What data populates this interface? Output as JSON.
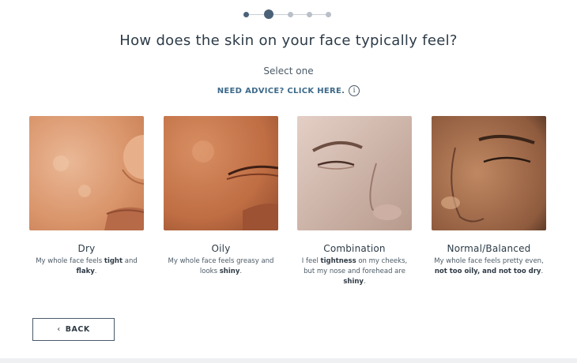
{
  "stepper": {
    "total_steps": 5,
    "current_step": 2
  },
  "page": {
    "title": "How does the skin on your face typically feel?",
    "subtitle": "Select one",
    "advice_link": "NEED ADVICE? CLICK HERE."
  },
  "options": [
    {
      "title": "Dry",
      "desc_parts": [
        "My whole face feels ",
        "tight",
        " and ",
        "flaky",
        "."
      ]
    },
    {
      "title": "Oily",
      "desc_parts": [
        "My whole face feels greasy and looks ",
        "shiny",
        "."
      ]
    },
    {
      "title": "Combination",
      "desc_parts": [
        "I feel ",
        "tightness",
        " on my cheeks, but my nose and forehead are ",
        "shiny",
        "."
      ]
    },
    {
      "title": "Normal/Balanced",
      "desc_parts": [
        "My whole face feels pretty even, ",
        "not too oily, and not too dry",
        "."
      ]
    }
  ],
  "back_label": "BACK",
  "colors": {
    "accent": "#4a6277",
    "link": "#3d6a8a",
    "text": "#2c3b48"
  }
}
